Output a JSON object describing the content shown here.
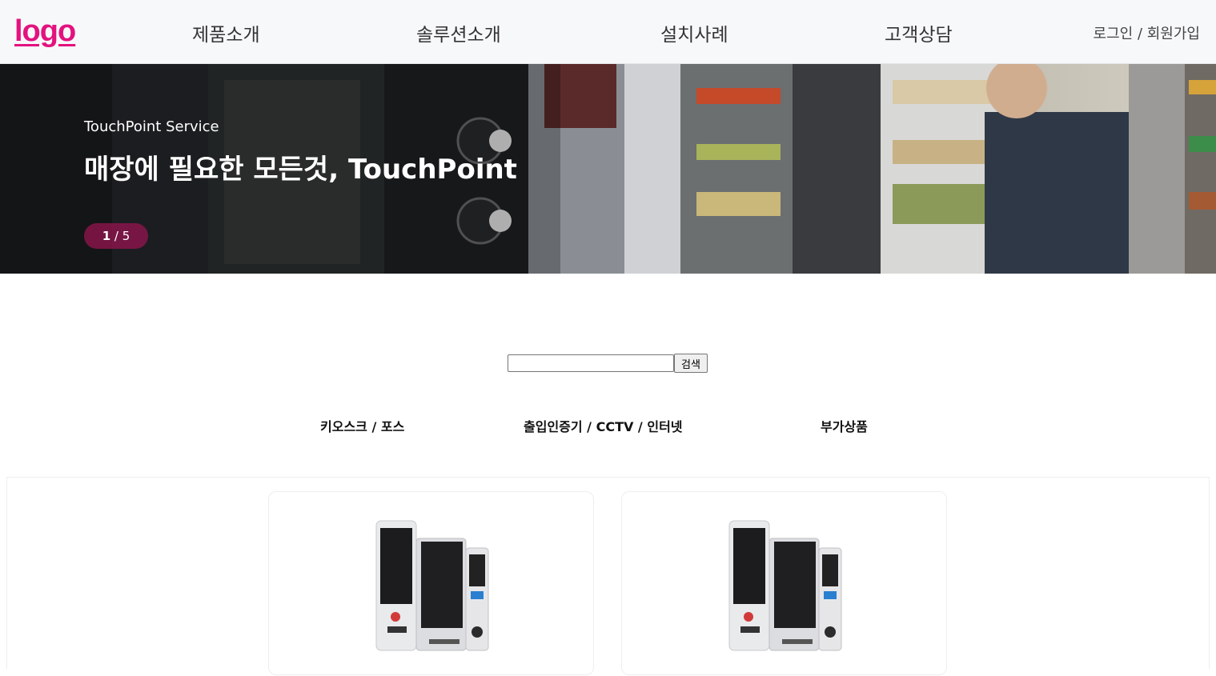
{
  "header": {
    "logo": "logo",
    "nav": [
      "제품소개",
      "솔루션소개",
      "설치사례",
      "고객상담"
    ],
    "auth": {
      "login": "로그인",
      "separator": " / ",
      "signup": "회원가입"
    }
  },
  "hero": {
    "subtitle": "TouchPoint Service",
    "title": "매장에 필요한 모든것, TouchPoint",
    "pager": {
      "current": "1",
      "separator": " / ",
      "total": "5"
    }
  },
  "search": {
    "value": "",
    "button_label": "검색"
  },
  "categories": [
    "키오스크 / 포스",
    "출입인증기 / CCTV / 인터넷",
    "부가상품"
  ],
  "colors": {
    "brand": "#e3127f",
    "pager_bg": "#96144f"
  }
}
